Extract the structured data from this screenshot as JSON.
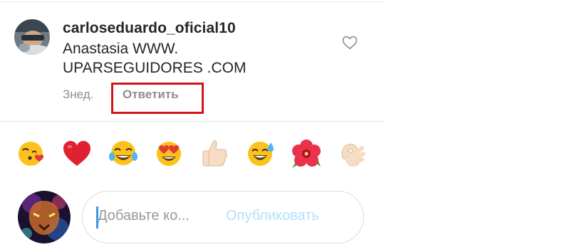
{
  "comment": {
    "username": "carloseduardo_oficial10",
    "text_lines": [
      "Anastasia WWW.",
      "UPARSEGUIDORES .COM"
    ],
    "timestamp": "Знед.",
    "reply_label": "Ответить",
    "like_icon": "heart-outline-icon"
  },
  "emoji_bar": [
    {
      "name": "kissing-heart-emoji",
      "glyph": "😘"
    },
    {
      "name": "red-heart-emoji",
      "glyph": "❤️"
    },
    {
      "name": "tears-of-joy-emoji",
      "glyph": "😂"
    },
    {
      "name": "heart-eyes-emoji",
      "glyph": "😍"
    },
    {
      "name": "thumbs-up-emoji",
      "glyph": "👍🏻"
    },
    {
      "name": "sweat-smile-emoji",
      "glyph": "😅"
    },
    {
      "name": "hibiscus-emoji",
      "glyph": "🌺"
    },
    {
      "name": "ok-hand-emoji",
      "glyph": "👌🏻"
    }
  ],
  "composer": {
    "placeholder": "Добавьте ко...",
    "publish_label": "Опубликовать"
  },
  "colors": {
    "highlight": "#d0161b",
    "publish_disabled": "#b2dffc",
    "caret": "#3897f0",
    "meta_text": "#8e8e8e"
  }
}
